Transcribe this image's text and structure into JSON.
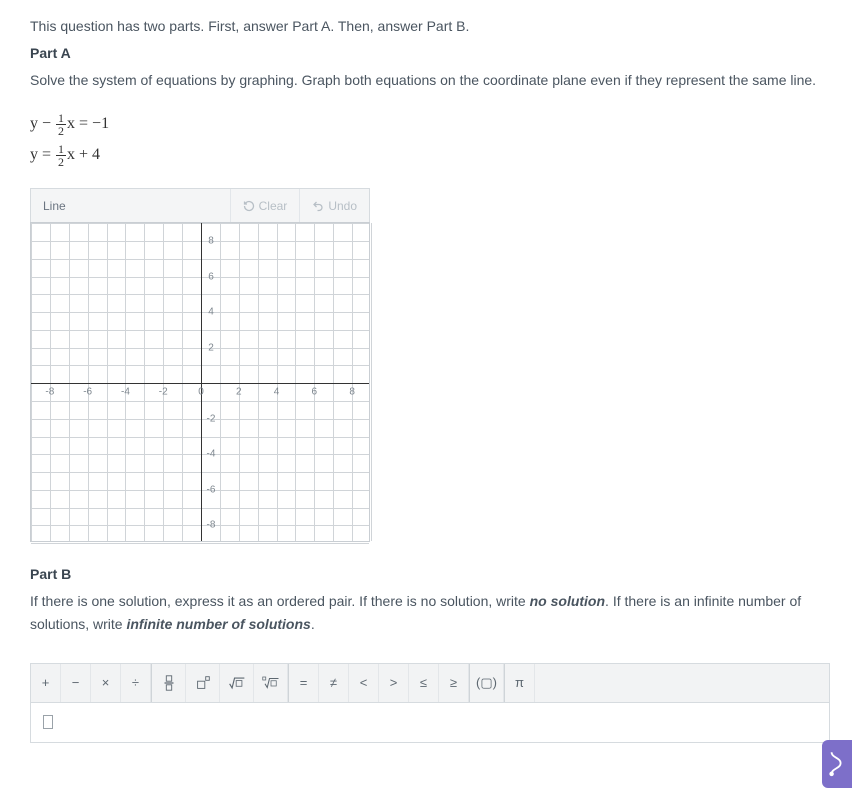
{
  "intro": "This question has two parts. First, answer Part A. Then, answer Part B.",
  "partA": {
    "label": "Part A",
    "prompt": "Solve the system of equations by graphing. Graph both equations on the coordinate plane even if they represent the same line.",
    "eq1_lhs_pre": "y − ",
    "eq1_frac_num": "1",
    "eq1_frac_den": "2",
    "eq1_lhs_post": "x = −1",
    "eq2_pre": "y = ",
    "eq2_frac_num": "1",
    "eq2_frac_den": "2",
    "eq2_post": "x + 4"
  },
  "graphToolbar": {
    "tool": "Line",
    "clear": "Clear",
    "undo": "Undo"
  },
  "chart_data": {
    "type": "scatter",
    "title": "",
    "xlabel": "",
    "ylabel": "",
    "xlim": [
      -9,
      9
    ],
    "ylim": [
      -9,
      9
    ],
    "x_ticks": [
      -8,
      -6,
      -4,
      -2,
      0,
      2,
      4,
      6,
      8
    ],
    "y_ticks": [
      -8,
      -6,
      -4,
      -2,
      2,
      4,
      6,
      8
    ],
    "grid": true,
    "series": []
  },
  "partB": {
    "label": "Part B",
    "prompt_1": "If there is one solution, express it as an ordered pair. If there is no solution, write ",
    "no_solution": "no solution",
    "prompt_2": ". If there is an infinite number of solutions, write ",
    "infinite": "infinite number of solutions",
    "prompt_3": "."
  },
  "mathToolbar": {
    "plus": "+",
    "minus": "−",
    "times": "×",
    "divide": "÷",
    "eq": "=",
    "neq": "≠",
    "lt": "<",
    "gt": ">",
    "le": "≤",
    "ge": "≥",
    "parens": "(▢)",
    "pi": "π"
  }
}
